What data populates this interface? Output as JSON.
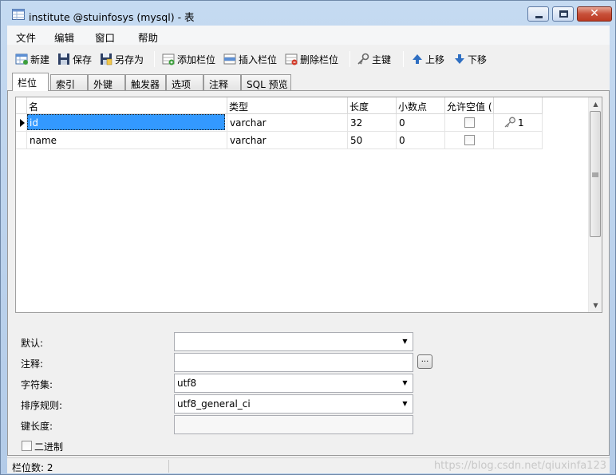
{
  "window": {
    "title": "institute @stuinfosys (mysql) - 表"
  },
  "menu": [
    "文件",
    "编辑",
    "窗口",
    "帮助"
  ],
  "toolbar": {
    "new": "新建",
    "save": "保存",
    "save_as": "另存为",
    "add_field": "添加栏位",
    "insert_field": "插入栏位",
    "delete_field": "删除栏位",
    "primary_key": "主键",
    "move_up": "上移",
    "move_down": "下移"
  },
  "tabs": [
    "栏位",
    "索引",
    "外键",
    "触发器",
    "选项",
    "注释",
    "SQL 预览"
  ],
  "grid": {
    "columns": [
      "名",
      "类型",
      "长度",
      "小数点",
      "允许空值 (",
      ""
    ],
    "rows": [
      {
        "name": "id",
        "type": "varchar",
        "length": "32",
        "decimals": "0",
        "nullable": false,
        "key": "1"
      },
      {
        "name": "name",
        "type": "varchar",
        "length": "50",
        "decimals": "0",
        "nullable": false,
        "key": ""
      }
    ]
  },
  "props": {
    "default_label": "默认:",
    "default_value": "",
    "comment_label": "注释:",
    "comment_value": "",
    "ellipsis": "...",
    "charset_label": "字符集:",
    "charset_value": "utf8",
    "collation_label": "排序规则:",
    "collation_value": "utf8_general_ci",
    "keylen_label": "键长度:",
    "keylen_value": "",
    "binary_label": "二进制"
  },
  "status": {
    "text": "栏位数: 2",
    "watermark": "https://blog.csdn.net/qiuxinfa123"
  }
}
